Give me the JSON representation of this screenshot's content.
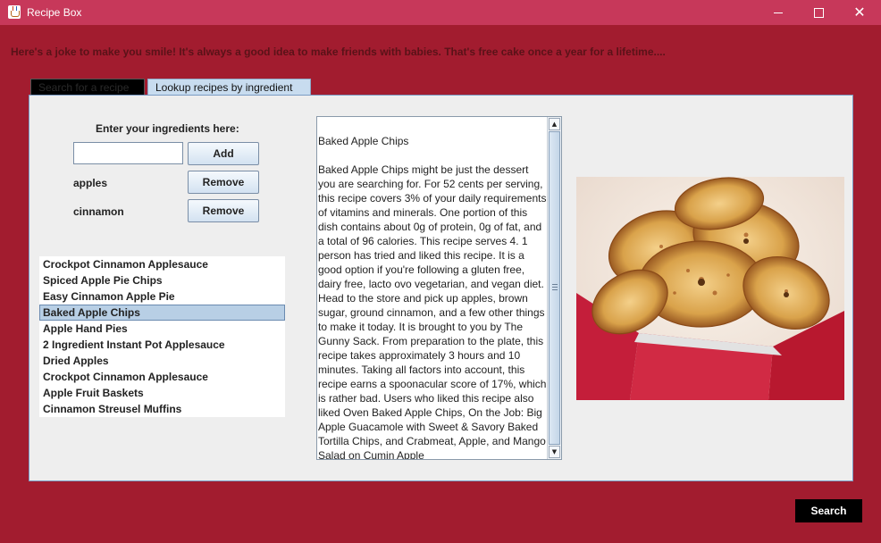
{
  "window": {
    "title": "Recipe Box",
    "minimize_icon": "minimize-icon",
    "maximize_icon": "maximize-icon",
    "close_icon": "close-icon",
    "close_glyph": "✕"
  },
  "joke": "Here's a joke to make you smile! It's always a good idea to make friends with babies. That's free cake once a year for a lifetime....",
  "tabs": [
    {
      "label": "Search for a recipe"
    },
    {
      "label": "Lookup recipes by ingredient"
    }
  ],
  "ingredients": {
    "prompt": "Enter your ingredients here:",
    "input_value": "",
    "add_label": "Add",
    "remove_label": "Remove",
    "items": [
      {
        "name": "apples"
      },
      {
        "name": "cinnamon"
      }
    ]
  },
  "recipes": {
    "selected": "Baked Apple Chips",
    "items": [
      "Crockpot Cinnamon Applesauce",
      "Spiced Apple Pie Chips",
      "Easy Cinnamon Apple Pie",
      "Baked Apple Chips",
      "Apple Hand Pies",
      "2 Ingredient Instant Pot Applesauce",
      "Dried Apples",
      "Crockpot Cinnamon Applesauce",
      "Apple Fruit Baskets",
      "Cinnamon Streusel Muffins"
    ]
  },
  "description": {
    "title": "Baked Apple Chips",
    "body": "Baked Apple Chips might be just the dessert you are searching for. For 52 cents per serving, this recipe covers 3% of your daily requirements of vitamins and minerals. One portion of this dish contains about 0g of protein, 0g of fat, and a total of 96 calories. This recipe serves 4. 1 person has tried and liked this recipe. It is a good option if you're following a gluten free, dairy free, lacto ovo vegetarian, and vegan diet. Head to the store and pick up apples, brown sugar, ground cinnamon, and a few other things to make it today. It is brought to you by The Gunny Sack. From preparation to the plate, this recipe takes approximately 3 hours and 10 minutes. Taking all factors into account, this recipe earns a spoonacular score of 17%, which is rather bad. Users who liked this recipe also liked Oven Baked Apple Chips, On the Job: Big Apple Guacamole with Sweet & Savory Baked Tortilla Chips, and Crabmeat, Apple, and Mango Salad on Cumin Apple",
    "scroll_up_glyph": "▲",
    "scroll_down_glyph": "▼"
  },
  "image": {
    "subject": "baked apple chips in a red paper basket"
  },
  "search_label": "Search",
  "colors": {
    "background": "#a21c2f",
    "titlebar": "#c7385a",
    "panel": "#eeeeee",
    "selected_row": "#b8cfe5"
  }
}
